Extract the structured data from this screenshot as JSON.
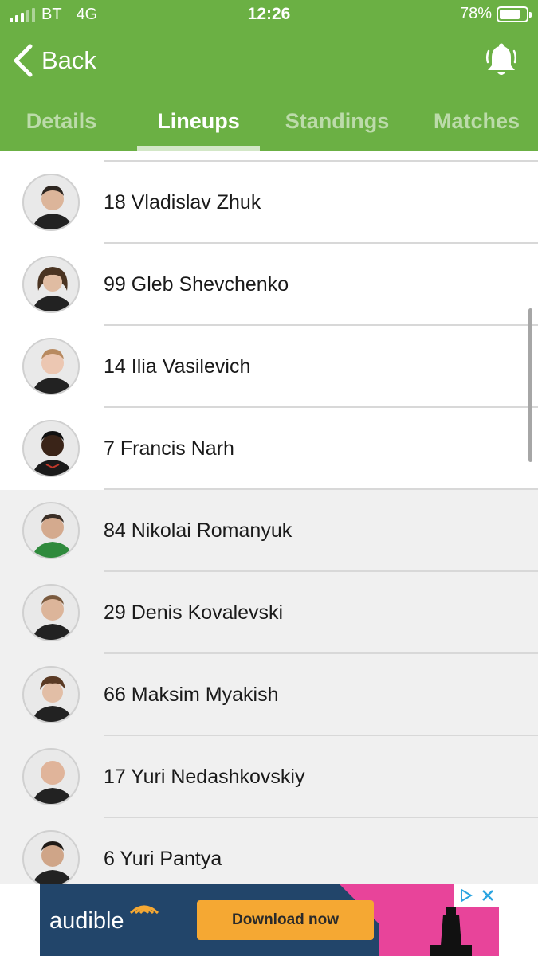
{
  "status_bar": {
    "carrier": "BT",
    "network": "4G",
    "time": "12:26",
    "battery_percent": "78%",
    "battery_level": 0.78
  },
  "nav": {
    "back_label": "Back",
    "bell_icon": "bell-icon"
  },
  "tabs": [
    {
      "label": "Details",
      "active": false
    },
    {
      "label": "Lineups",
      "active": true
    },
    {
      "label": "Standings",
      "active": false
    },
    {
      "label": "Matches",
      "active": false
    }
  ],
  "players": [
    {
      "label": "18 Vladislav Zhuk",
      "group": "starter"
    },
    {
      "label": "99 Gleb Shevchenko",
      "group": "starter"
    },
    {
      "label": "14 Ilia Vasilevich",
      "group": "starter"
    },
    {
      "label": "7 Francis Narh",
      "group": "starter"
    },
    {
      "label": "84 Nikolai Romanyuk",
      "group": "substitute"
    },
    {
      "label": "29 Denis Kovalevski",
      "group": "substitute"
    },
    {
      "label": "66 Maksim Myakish",
      "group": "substitute"
    },
    {
      "label": "17 Yuri Nedashkovskiy",
      "group": "substitute"
    },
    {
      "label": "6 Yuri Pantya",
      "group": "substitute"
    }
  ],
  "ad": {
    "brand": "audible",
    "cta": "Download now"
  },
  "colors": {
    "header_green": "#6bb044",
    "bench_background": "#f0f0f0",
    "ad_navy": "#22456a",
    "ad_orange": "#f5a833",
    "ad_pink": "#e8449a"
  }
}
